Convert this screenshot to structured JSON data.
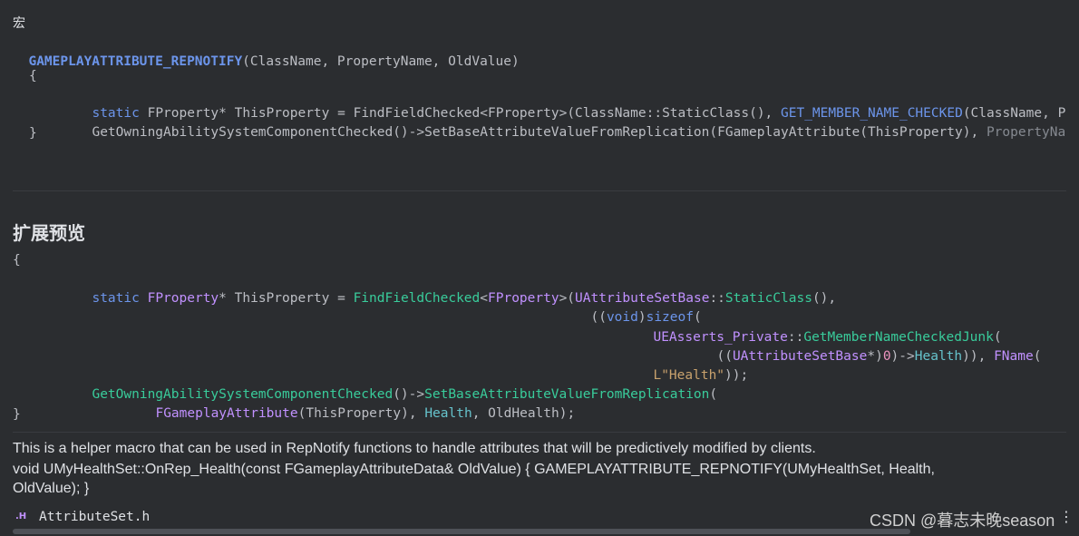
{
  "header": {
    "macro_label": "宏",
    "signature_name": "GAMEPLAYATTRIBUTE_REPNOTIFY",
    "signature_params": "(ClassName, PropertyName, OldValue)"
  },
  "macro_body": {
    "open_brace": "{",
    "line1_static": "static",
    "line1_type": "FProperty*",
    "line1_var": " ThisProperty = ",
    "line1_fn": "FindFieldChecked",
    "line1_tmpl": "<FProperty>",
    "line1_rest": "(ClassName::StaticClass(), ",
    "line1_macro": "GET_MEMBER_NAME_CHECKED",
    "line1_tail": "(ClassName, P",
    "line2_fn": "GetOwningAbilitySystemComponentChecked",
    "line2_rest": "()->SetBaseAttributeValueFromReplication(FGameplayAttribute(ThisProperty), ",
    "line2_tail": "PropertyNa",
    "close_brace": "}"
  },
  "expansion": {
    "heading": "扩展预览",
    "open_brace": "{",
    "l1_static": "static",
    "l1_type": "FProperty",
    "l1_ptr": "* ThisProperty = ",
    "l1_fn": "FindFieldChecked",
    "l1_lt": "<",
    "l1_tmpl": "FProperty",
    "l1_gt": ">(",
    "l1_cls": "UAttributeSetBase",
    "l1_sep": "::",
    "l1_static_class": "StaticClass",
    "l1_end": "(),",
    "l2_open": "((",
    "l2_void": "void",
    "l2_close": ")",
    "l2_sizeof": "sizeof",
    "l2_paren": "(",
    "l3_ns": "UEAsserts_Private",
    "l3_sep": "::",
    "l3_fn": "GetMemberNameCheckedJunk",
    "l3_paren": "(",
    "l4_open": "((",
    "l4_cls": "UAttributeSetBase",
    "l4_ptr": "*)",
    "l4_zero": "0",
    "l4_arrow": ")->",
    "l4_member": "Health",
    "l4_close": ")), ",
    "l4_fname": "FName",
    "l4_paren": "(",
    "l5_str": "L\"Health\"",
    "l5_end": "));",
    "l6_fn": "GetOwningAbilitySystemComponentChecked",
    "l6_arrow": "()->",
    "l6_method": "SetBaseAttributeValueFromReplication",
    "l6_paren": "(",
    "l7_type": "FGameplayAttribute",
    "l7_open": "(",
    "l7_var": "ThisProperty",
    "l7_close": "), ",
    "l7_health": "Health",
    "l7_comma": ", ",
    "l7_old": "OldHealth",
    "l7_end": ");",
    "close_brace": "}"
  },
  "description": {
    "line1": "This is a helper macro that can be used in RepNotify functions to handle attributes that will be predictively modified by clients.",
    "line2": "void UMyHealthSet::OnRep_Health(const FGameplayAttributeData& OldValue) { GAMEPLAYATTRIBUTE_REPNOTIFY(UMyHealthSet, Health,",
    "line3": "OldValue); }"
  },
  "footer": {
    "file_icon_label": ".H",
    "file_name": "AttributeSet.h",
    "watermark": "CSDN @暮志未晚season",
    "more_icon": "⋮"
  },
  "colors": {
    "background": "#2b2d30",
    "keyword": "#6c95eb",
    "type": "#c191ff",
    "function_green": "#39cc9b",
    "string": "#c9a26d"
  }
}
